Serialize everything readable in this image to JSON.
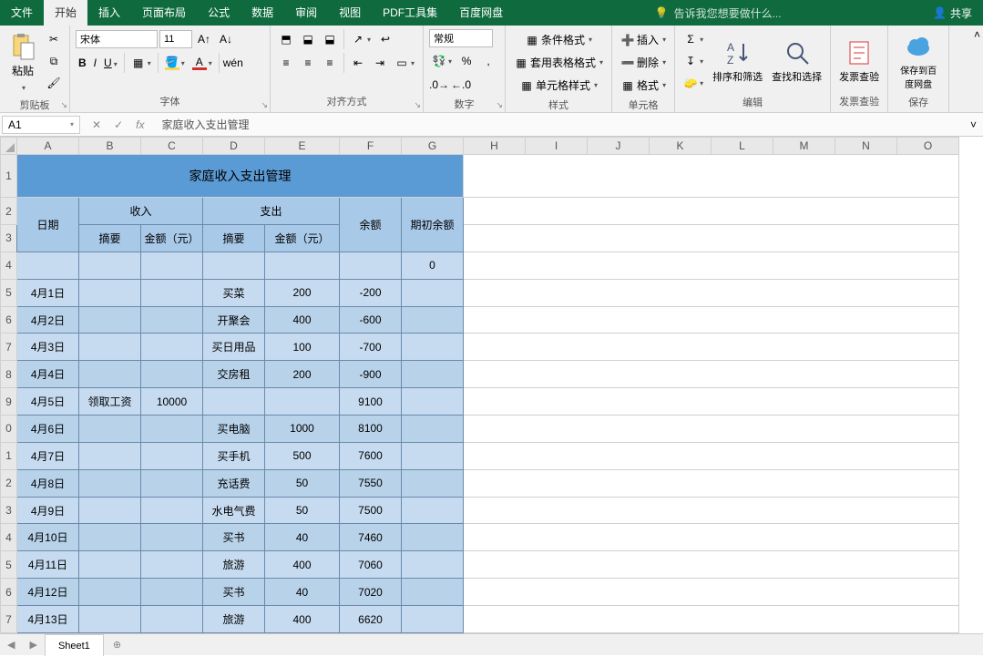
{
  "titlebar": {
    "tabs": [
      "文件",
      "开始",
      "插入",
      "页面布局",
      "公式",
      "数据",
      "审阅",
      "视图",
      "PDF工具集",
      "百度网盘"
    ],
    "active_tab_index": 1,
    "search_hint": "告诉我您想要做什么...",
    "share_label": "共享"
  },
  "ribbon": {
    "clipboard": {
      "paste": "粘贴",
      "label": "剪贴板"
    },
    "font": {
      "name": "宋体",
      "size": "11",
      "label": "字体"
    },
    "align": {
      "label": "对齐方式"
    },
    "number": {
      "format": "常规",
      "label": "数字"
    },
    "styles": {
      "cond": "条件格式",
      "tbl": "套用表格格式",
      "cell": "单元格样式",
      "label": "样式"
    },
    "cells": {
      "insert": "插入",
      "delete": "删除",
      "format": "格式",
      "label": "单元格"
    },
    "editing": {
      "sort": "排序和筛选",
      "find": "查找和选择",
      "label": "编辑"
    },
    "invoice": {
      "name": "发票查验",
      "label": "发票查验"
    },
    "save": {
      "name": "保存到百度网盘",
      "label": "保存"
    }
  },
  "formula_bar": {
    "name_box": "A1",
    "formula": "家庭收入支出管理"
  },
  "columns": [
    "A",
    "B",
    "C",
    "D",
    "E",
    "F",
    "G",
    "H",
    "I",
    "J",
    "K",
    "L",
    "M",
    "N",
    "O"
  ],
  "row_numbers": [
    "1",
    "2",
    "3",
    "4",
    "5",
    "6",
    "7",
    "8",
    "9",
    "0",
    "1",
    "2",
    "3",
    "4",
    "5",
    "6",
    "7"
  ],
  "table": {
    "title": "家庭收入支出管理",
    "head": {
      "date": "日期",
      "income": "收入",
      "expense": "支出",
      "balance": "余额",
      "opening": "期初余额",
      "summary": "摘要",
      "amount": "金额（元）"
    },
    "initial_balance": "0",
    "rows": [
      {
        "date": "4月1日",
        "in_sum": "",
        "in_amt": "",
        "ex_sum": "买菜",
        "ex_amt": "200",
        "bal": "-200"
      },
      {
        "date": "4月2日",
        "in_sum": "",
        "in_amt": "",
        "ex_sum": "开聚会",
        "ex_amt": "400",
        "bal": "-600"
      },
      {
        "date": "4月3日",
        "in_sum": "",
        "in_amt": "",
        "ex_sum": "买日用品",
        "ex_amt": "100",
        "bal": "-700"
      },
      {
        "date": "4月4日",
        "in_sum": "",
        "in_amt": "",
        "ex_sum": "交房租",
        "ex_amt": "200",
        "bal": "-900"
      },
      {
        "date": "4月5日",
        "in_sum": "领取工资",
        "in_amt": "10000",
        "ex_sum": "",
        "ex_amt": "",
        "bal": "9100"
      },
      {
        "date": "4月6日",
        "in_sum": "",
        "in_amt": "",
        "ex_sum": "买电脑",
        "ex_amt": "1000",
        "bal": "8100"
      },
      {
        "date": "4月7日",
        "in_sum": "",
        "in_amt": "",
        "ex_sum": "买手机",
        "ex_amt": "500",
        "bal": "7600"
      },
      {
        "date": "4月8日",
        "in_sum": "",
        "in_amt": "",
        "ex_sum": "充话费",
        "ex_amt": "50",
        "bal": "7550"
      },
      {
        "date": "4月9日",
        "in_sum": "",
        "in_amt": "",
        "ex_sum": "水电气费",
        "ex_amt": "50",
        "bal": "7500"
      },
      {
        "date": "4月10日",
        "in_sum": "",
        "in_amt": "",
        "ex_sum": "买书",
        "ex_amt": "40",
        "bal": "7460"
      },
      {
        "date": "4月11日",
        "in_sum": "",
        "in_amt": "",
        "ex_sum": "旅游",
        "ex_amt": "400",
        "bal": "7060"
      },
      {
        "date": "4月12日",
        "in_sum": "",
        "in_amt": "",
        "ex_sum": "买书",
        "ex_amt": "40",
        "bal": "7020"
      },
      {
        "date": "4月13日",
        "in_sum": "",
        "in_amt": "",
        "ex_sum": "旅游",
        "ex_amt": "400",
        "bal": "6620"
      }
    ]
  },
  "sheet_tabs": {
    "sheet1": "Sheet1"
  }
}
